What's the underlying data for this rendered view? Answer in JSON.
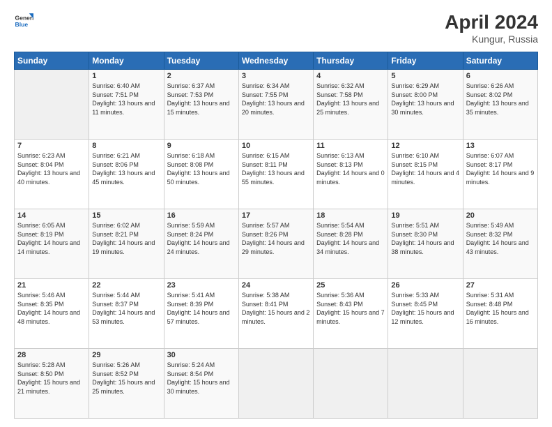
{
  "header": {
    "logo_general": "General",
    "logo_blue": "Blue",
    "title": "April 2024",
    "subtitle": "Kungur, Russia"
  },
  "days_header": [
    "Sunday",
    "Monday",
    "Tuesday",
    "Wednesday",
    "Thursday",
    "Friday",
    "Saturday"
  ],
  "weeks": [
    [
      {
        "day": "",
        "sunrise": "",
        "sunset": "",
        "daylight": ""
      },
      {
        "day": "1",
        "sunrise": "Sunrise: 6:40 AM",
        "sunset": "Sunset: 7:51 PM",
        "daylight": "Daylight: 13 hours and 11 minutes."
      },
      {
        "day": "2",
        "sunrise": "Sunrise: 6:37 AM",
        "sunset": "Sunset: 7:53 PM",
        "daylight": "Daylight: 13 hours and 15 minutes."
      },
      {
        "day": "3",
        "sunrise": "Sunrise: 6:34 AM",
        "sunset": "Sunset: 7:55 PM",
        "daylight": "Daylight: 13 hours and 20 minutes."
      },
      {
        "day": "4",
        "sunrise": "Sunrise: 6:32 AM",
        "sunset": "Sunset: 7:58 PM",
        "daylight": "Daylight: 13 hours and 25 minutes."
      },
      {
        "day": "5",
        "sunrise": "Sunrise: 6:29 AM",
        "sunset": "Sunset: 8:00 PM",
        "daylight": "Daylight: 13 hours and 30 minutes."
      },
      {
        "day": "6",
        "sunrise": "Sunrise: 6:26 AM",
        "sunset": "Sunset: 8:02 PM",
        "daylight": "Daylight: 13 hours and 35 minutes."
      }
    ],
    [
      {
        "day": "7",
        "sunrise": "Sunrise: 6:23 AM",
        "sunset": "Sunset: 8:04 PM",
        "daylight": "Daylight: 13 hours and 40 minutes."
      },
      {
        "day": "8",
        "sunrise": "Sunrise: 6:21 AM",
        "sunset": "Sunset: 8:06 PM",
        "daylight": "Daylight: 13 hours and 45 minutes."
      },
      {
        "day": "9",
        "sunrise": "Sunrise: 6:18 AM",
        "sunset": "Sunset: 8:08 PM",
        "daylight": "Daylight: 13 hours and 50 minutes."
      },
      {
        "day": "10",
        "sunrise": "Sunrise: 6:15 AM",
        "sunset": "Sunset: 8:11 PM",
        "daylight": "Daylight: 13 hours and 55 minutes."
      },
      {
        "day": "11",
        "sunrise": "Sunrise: 6:13 AM",
        "sunset": "Sunset: 8:13 PM",
        "daylight": "Daylight: 14 hours and 0 minutes."
      },
      {
        "day": "12",
        "sunrise": "Sunrise: 6:10 AM",
        "sunset": "Sunset: 8:15 PM",
        "daylight": "Daylight: 14 hours and 4 minutes."
      },
      {
        "day": "13",
        "sunrise": "Sunrise: 6:07 AM",
        "sunset": "Sunset: 8:17 PM",
        "daylight": "Daylight: 14 hours and 9 minutes."
      }
    ],
    [
      {
        "day": "14",
        "sunrise": "Sunrise: 6:05 AM",
        "sunset": "Sunset: 8:19 PM",
        "daylight": "Daylight: 14 hours and 14 minutes."
      },
      {
        "day": "15",
        "sunrise": "Sunrise: 6:02 AM",
        "sunset": "Sunset: 8:21 PM",
        "daylight": "Daylight: 14 hours and 19 minutes."
      },
      {
        "day": "16",
        "sunrise": "Sunrise: 5:59 AM",
        "sunset": "Sunset: 8:24 PM",
        "daylight": "Daylight: 14 hours and 24 minutes."
      },
      {
        "day": "17",
        "sunrise": "Sunrise: 5:57 AM",
        "sunset": "Sunset: 8:26 PM",
        "daylight": "Daylight: 14 hours and 29 minutes."
      },
      {
        "day": "18",
        "sunrise": "Sunrise: 5:54 AM",
        "sunset": "Sunset: 8:28 PM",
        "daylight": "Daylight: 14 hours and 34 minutes."
      },
      {
        "day": "19",
        "sunrise": "Sunrise: 5:51 AM",
        "sunset": "Sunset: 8:30 PM",
        "daylight": "Daylight: 14 hours and 38 minutes."
      },
      {
        "day": "20",
        "sunrise": "Sunrise: 5:49 AM",
        "sunset": "Sunset: 8:32 PM",
        "daylight": "Daylight: 14 hours and 43 minutes."
      }
    ],
    [
      {
        "day": "21",
        "sunrise": "Sunrise: 5:46 AM",
        "sunset": "Sunset: 8:35 PM",
        "daylight": "Daylight: 14 hours and 48 minutes."
      },
      {
        "day": "22",
        "sunrise": "Sunrise: 5:44 AM",
        "sunset": "Sunset: 8:37 PM",
        "daylight": "Daylight: 14 hours and 53 minutes."
      },
      {
        "day": "23",
        "sunrise": "Sunrise: 5:41 AM",
        "sunset": "Sunset: 8:39 PM",
        "daylight": "Daylight: 14 hours and 57 minutes."
      },
      {
        "day": "24",
        "sunrise": "Sunrise: 5:38 AM",
        "sunset": "Sunset: 8:41 PM",
        "daylight": "Daylight: 15 hours and 2 minutes."
      },
      {
        "day": "25",
        "sunrise": "Sunrise: 5:36 AM",
        "sunset": "Sunset: 8:43 PM",
        "daylight": "Daylight: 15 hours and 7 minutes."
      },
      {
        "day": "26",
        "sunrise": "Sunrise: 5:33 AM",
        "sunset": "Sunset: 8:45 PM",
        "daylight": "Daylight: 15 hours and 12 minutes."
      },
      {
        "day": "27",
        "sunrise": "Sunrise: 5:31 AM",
        "sunset": "Sunset: 8:48 PM",
        "daylight": "Daylight: 15 hours and 16 minutes."
      }
    ],
    [
      {
        "day": "28",
        "sunrise": "Sunrise: 5:28 AM",
        "sunset": "Sunset: 8:50 PM",
        "daylight": "Daylight: 15 hours and 21 minutes."
      },
      {
        "day": "29",
        "sunrise": "Sunrise: 5:26 AM",
        "sunset": "Sunset: 8:52 PM",
        "daylight": "Daylight: 15 hours and 25 minutes."
      },
      {
        "day": "30",
        "sunrise": "Sunrise: 5:24 AM",
        "sunset": "Sunset: 8:54 PM",
        "daylight": "Daylight: 15 hours and 30 minutes."
      },
      {
        "day": "",
        "sunrise": "",
        "sunset": "",
        "daylight": ""
      },
      {
        "day": "",
        "sunrise": "",
        "sunset": "",
        "daylight": ""
      },
      {
        "day": "",
        "sunrise": "",
        "sunset": "",
        "daylight": ""
      },
      {
        "day": "",
        "sunrise": "",
        "sunset": "",
        "daylight": ""
      }
    ]
  ]
}
